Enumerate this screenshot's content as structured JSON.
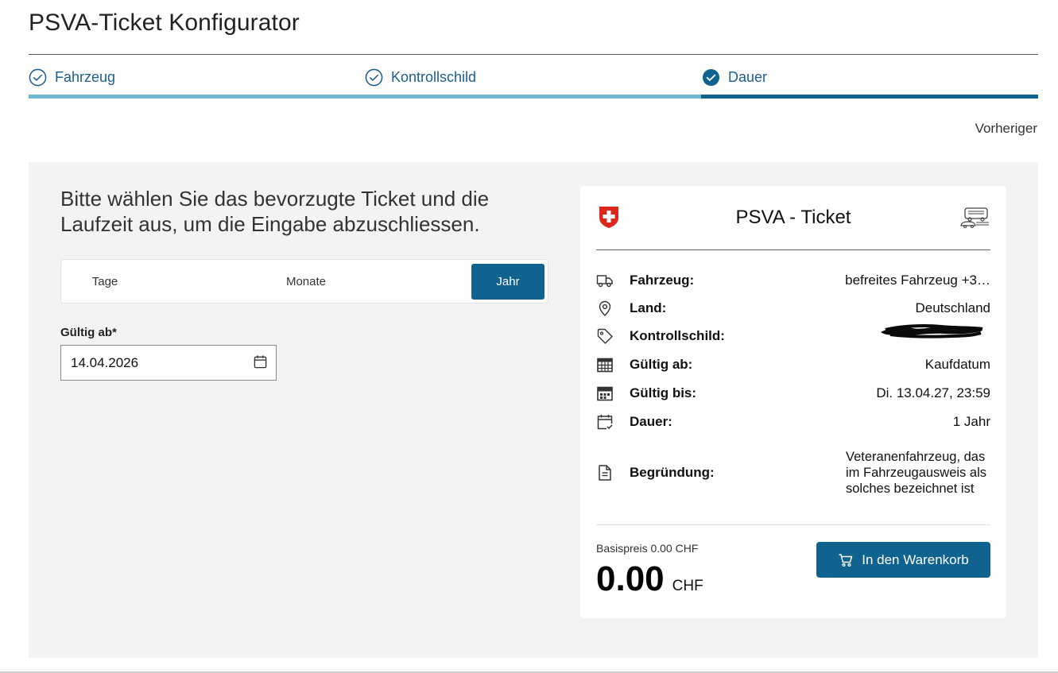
{
  "page": {
    "title": "PSVA-Ticket Konfigurator",
    "previous_label": "Vorheriger"
  },
  "steps": [
    {
      "label": "Fahrzeug",
      "state": "done",
      "icon": "check-circle-outline"
    },
    {
      "label": "Kontrollschild",
      "state": "done",
      "icon": "check-circle-outline"
    },
    {
      "label": "Dauer",
      "state": "active",
      "icon": "check-circle-filled"
    }
  ],
  "form": {
    "intro": "Bitte wählen Sie das bevorzugte Ticket und die Laufzeit aus, um die Eingabe abzuschliessen.",
    "durations": [
      "Tage",
      "Monate",
      "Jahr"
    ],
    "selected_duration": "Jahr",
    "valid_from_label": "Gültig ab*",
    "valid_from_value": "14.04.2026"
  },
  "card": {
    "title": "PSVA - Ticket",
    "rows": [
      {
        "label": "Fahrzeug:",
        "value": "befreites Fahrzeug +3…",
        "icon": "truck-icon"
      },
      {
        "label": "Land:",
        "value": "Deutschland",
        "icon": "location-pin-icon"
      },
      {
        "label": "Kontrollschild:",
        "value": "",
        "icon": "tag-icon"
      },
      {
        "label": "Gültig ab:",
        "value": "Kaufdatum",
        "icon": "calendar-grid-icon"
      },
      {
        "label": "Gültig bis:",
        "value": "Di. 13.04.27, 23:59",
        "icon": "calendar-icon"
      },
      {
        "label": "Dauer:",
        "value": "1 Jahr",
        "icon": "calendar-check-icon"
      },
      {
        "label": "Begründung:",
        "value": "Veteranenfahrzeug, das im Fahrzeugausweis als solches bezeichnet ist",
        "icon": "document-icon"
      }
    ],
    "base_price": "Basispreis 0.00 CHF",
    "price_amount": "0.00",
    "price_currency": "CHF",
    "cart_button": "In den Warenkorb"
  },
  "colors": {
    "primary": "#10628f",
    "step_done_bar": "#6fbad3",
    "panel_bg": "#f3f3f3",
    "swiss_red": "#da291c"
  }
}
